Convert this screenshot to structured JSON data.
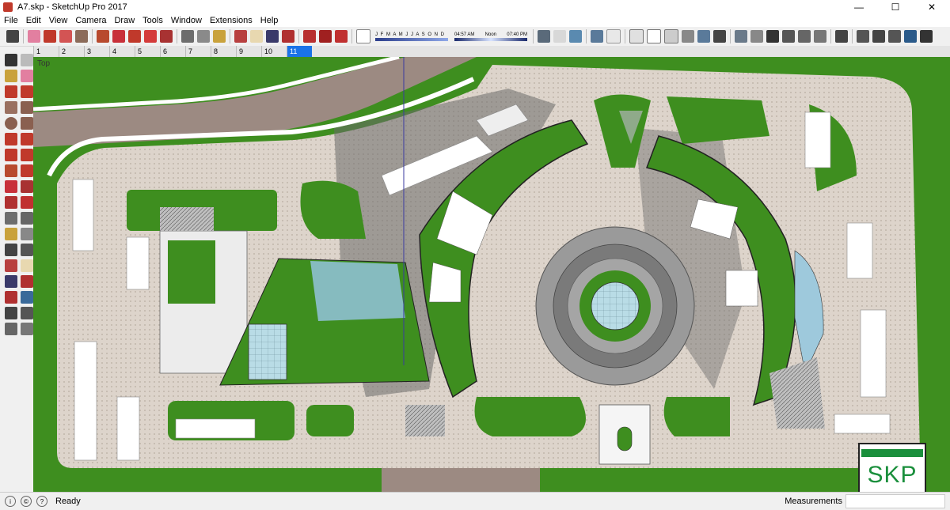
{
  "window": {
    "title": "A7.skp - SketchUp Pro 2017",
    "minimize": "—",
    "maximize": "☐",
    "close": "✕"
  },
  "menu": [
    "File",
    "Edit",
    "View",
    "Camera",
    "Draw",
    "Tools",
    "Window",
    "Extensions",
    "Help"
  ],
  "shadows": {
    "months": "J F M A M J J A S O N D",
    "time_start": "04:57 AM",
    "time_mid": "Noon",
    "time_end": "07:40 PM"
  },
  "scenes": [
    "1",
    "2",
    "3",
    "4",
    "5",
    "6",
    "7",
    "8",
    "9",
    "10",
    "11"
  ],
  "active_scene": "11",
  "view": {
    "label": "Top"
  },
  "status": {
    "text": "Ready",
    "measurements_label": "Measurements",
    "measurements_value": ""
  },
  "badge": {
    "text": "SKP"
  },
  "colors": {
    "grass": "#3e8e1f",
    "paving": "#d8cfc6",
    "road": "#9c8a82",
    "water": "#9ec9dc",
    "shadow": "#6a6a6a",
    "accent": "#1a73e8"
  },
  "toolbar_icons": [
    "select-icon",
    "eraser-icon",
    "pencil-icon",
    "shapes-icon",
    "paint-icon",
    "push-pull-icon",
    "rotate-icon",
    "move-icon",
    "scale-icon",
    "offset-icon",
    "tape-measure-icon",
    "text-icon",
    "paint-bucket-icon",
    "orbit-icon",
    "pan-icon",
    "zoom-icon",
    "zoom-extents-icon",
    "warehouse-icon",
    "extension-icon",
    "shadow-toggle-icon",
    "fog-icon",
    "section-icon",
    "iso-view-icon",
    "top-view-icon",
    "front-view-icon",
    "right-view-icon",
    "back-view-icon",
    "left-view-icon",
    "xray-icon",
    "wireframe-icon",
    "hidden-line-icon",
    "shaded-icon",
    "textured-icon",
    "monochrome-icon",
    "house-icon",
    "component-icon"
  ]
}
